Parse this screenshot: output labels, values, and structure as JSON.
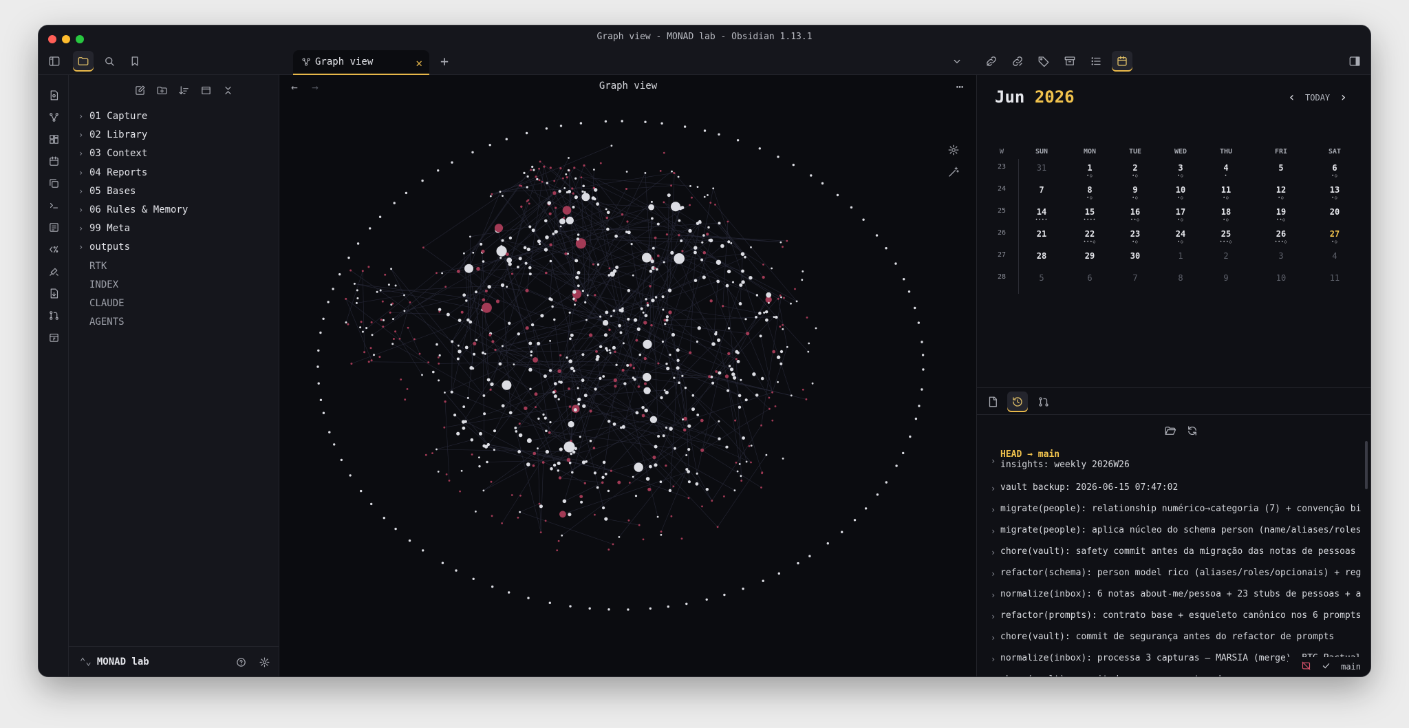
{
  "window": {
    "title": "Graph view - MONAD lab - Obsidian 1.13.1"
  },
  "tabs": {
    "active_tab_label": "Graph view",
    "close_glyph": "✕",
    "new_tab_glyph": "+"
  },
  "graph": {
    "header_title": "Graph view",
    "more_glyph": "⋯",
    "back_glyph": "←",
    "forward_glyph": "→",
    "colors": {
      "node": "#dcdde3",
      "tag_node": "#a23a55",
      "edge": "#3b3d55"
    }
  },
  "explorer": {
    "folders": [
      {
        "label": "01 Capture"
      },
      {
        "label": "02 Library"
      },
      {
        "label": "03 Context"
      },
      {
        "label": "04 Reports"
      },
      {
        "label": "05 Bases"
      },
      {
        "label": "06 Rules & Memory"
      },
      {
        "label": "99 Meta"
      },
      {
        "label": "outputs"
      }
    ],
    "files": [
      {
        "label": "RTK"
      },
      {
        "label": "INDEX"
      },
      {
        "label": "CLAUDE"
      },
      {
        "label": "AGENTS"
      }
    ],
    "chevron_glyph": "›",
    "vault_name": "MONAD lab",
    "vault_switch_glyph": "⌃⌄"
  },
  "calendar": {
    "month": "Jun",
    "year": "2026",
    "today_label": "TODAY",
    "prev_glyph": "‹",
    "next_glyph": "›",
    "week_header": "W",
    "day_names": [
      "SUN",
      "MON",
      "TUE",
      "WED",
      "THU",
      "FRI",
      "SAT"
    ],
    "weeks": [
      {
        "week": "23",
        "days": [
          {
            "d": "31",
            "muted": true,
            "dots": ""
          },
          {
            "d": "1",
            "dots": "•○"
          },
          {
            "d": "2",
            "dots": "•○"
          },
          {
            "d": "3",
            "dots": "•○"
          },
          {
            "d": "4",
            "dots": "•"
          },
          {
            "d": "5",
            "dots": ""
          },
          {
            "d": "6",
            "dots": "•○"
          }
        ]
      },
      {
        "week": "24",
        "days": [
          {
            "d": "7",
            "dots": ""
          },
          {
            "d": "8",
            "dots": "•○"
          },
          {
            "d": "9",
            "dots": "•○"
          },
          {
            "d": "10",
            "dots": "•○"
          },
          {
            "d": "11",
            "dots": "•○"
          },
          {
            "d": "12",
            "dots": "•○"
          },
          {
            "d": "13",
            "dots": "•○"
          }
        ]
      },
      {
        "week": "25",
        "days": [
          {
            "d": "14",
            "dots": "••••"
          },
          {
            "d": "15",
            "dots": "••••"
          },
          {
            "d": "16",
            "dots": "••○"
          },
          {
            "d": "17",
            "dots": "•○"
          },
          {
            "d": "18",
            "dots": "•○"
          },
          {
            "d": "19",
            "dots": "••○"
          },
          {
            "d": "20",
            "dots": ""
          }
        ]
      },
      {
        "week": "26",
        "days": [
          {
            "d": "21",
            "dots": ""
          },
          {
            "d": "22",
            "dots": "•••○"
          },
          {
            "d": "23",
            "dots": "•○"
          },
          {
            "d": "24",
            "dots": "•○"
          },
          {
            "d": "25",
            "dots": "•••○"
          },
          {
            "d": "26",
            "dots": "•••○"
          },
          {
            "d": "27",
            "today": true,
            "dots": "•○"
          }
        ]
      },
      {
        "week": "27",
        "days": [
          {
            "d": "28",
            "dots": ""
          },
          {
            "d": "29",
            "dots": ""
          },
          {
            "d": "30",
            "dots": ""
          },
          {
            "d": "1",
            "muted": true,
            "dots": ""
          },
          {
            "d": "2",
            "muted": true,
            "dots": ""
          },
          {
            "d": "3",
            "muted": true,
            "dots": ""
          },
          {
            "d": "4",
            "muted": true,
            "dots": ""
          }
        ]
      },
      {
        "week": "28",
        "days": [
          {
            "d": "5",
            "muted": true,
            "dots": ""
          },
          {
            "d": "6",
            "muted": true,
            "dots": ""
          },
          {
            "d": "7",
            "muted": true,
            "dots": ""
          },
          {
            "d": "8",
            "muted": true,
            "dots": ""
          },
          {
            "d": "9",
            "muted": true,
            "dots": ""
          },
          {
            "d": "10",
            "muted": true,
            "dots": ""
          },
          {
            "d": "11",
            "muted": true,
            "dots": ""
          }
        ]
      }
    ]
  },
  "git": {
    "head_label": "HEAD → main",
    "commits": [
      {
        "message": "insights: weekly 2026W26",
        "is_head": true
      },
      {
        "message": "vault backup: 2026-06-15 07:47:02"
      },
      {
        "message": "migrate(people): relationship numérico→categoria (7) + convenção bi"
      },
      {
        "message": "migrate(people): aplica núcleo do schema person (name/aliases/roles"
      },
      {
        "message": "chore(vault): safety commit antes da migração das notas de pessoas"
      },
      {
        "message": "refactor(schema): person model rico (aliases/roles/opcionais) + reg"
      },
      {
        "message": "normalize(inbox): 6 notas about-me/pessoa + 23 stubs de pessoas + a"
      },
      {
        "message": "refactor(prompts): contrato base + esqueleto canônico nos 6 prompts"
      },
      {
        "message": "chore(vault): commit de segurança antes do refactor de prompts"
      },
      {
        "message": "normalize(inbox): processa 3 capturas — MARSIA (merge), BTG Pactual"
      },
      {
        "message": "chore(vault): commit de segurança antes do processamento do inbox ("
      }
    ],
    "chevron_glyph": "›",
    "branch": "main"
  }
}
